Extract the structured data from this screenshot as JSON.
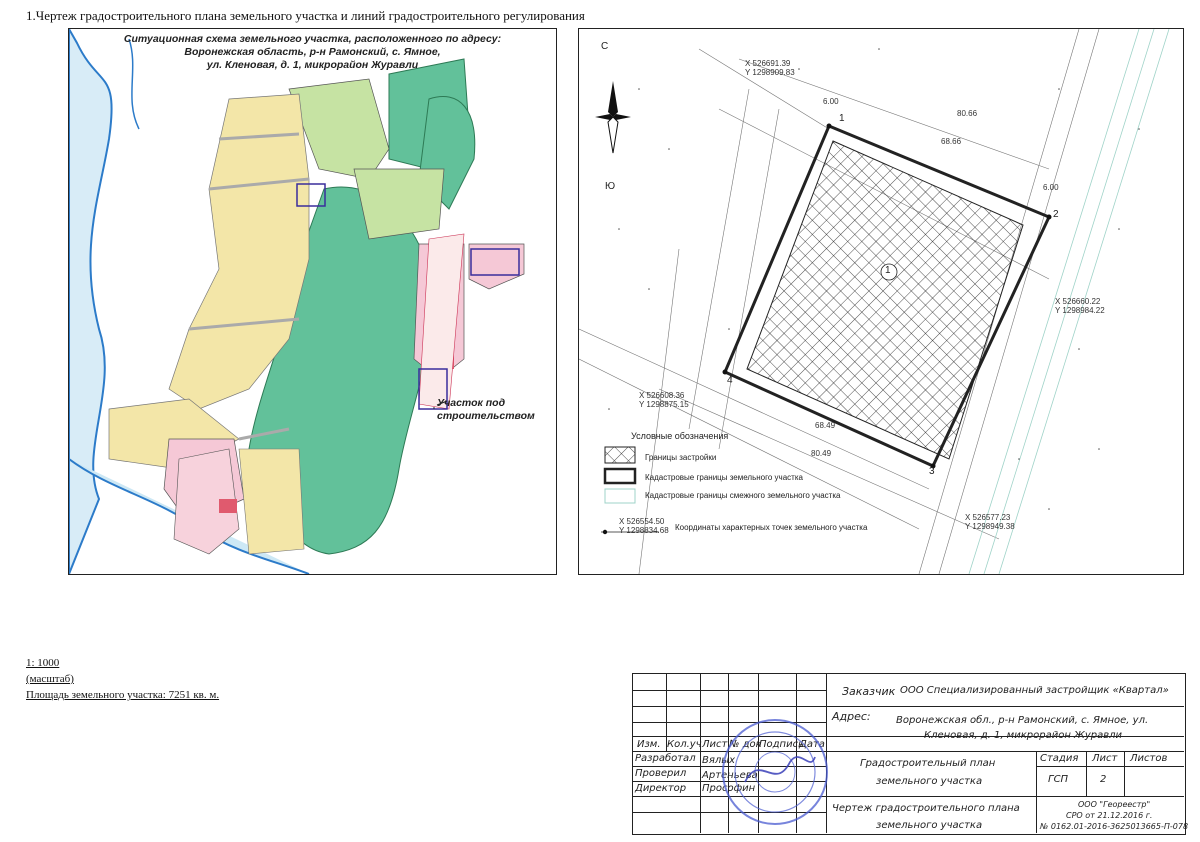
{
  "page_title": "1.Чертеж градостроительного плана земельного участка и линий градостроительного регулирования",
  "situational": {
    "title_line1": "Ситуационная схема земельного участка, расположенного по адресу:",
    "title_line2": "Воронежская область, р-н Рамонский, с. Ямное,",
    "title_line3": "ул. Кленовая, д. 1, микрорайон Журавли",
    "site_label_line1": "Участок под",
    "site_label_line2": "строительством"
  },
  "plan": {
    "compass_north": "С",
    "compass_south": "Ю",
    "points": [
      {
        "n": "1",
        "x": "X 526691.39",
        "y": "Y 1298909.83"
      },
      {
        "n": "2",
        "x": "X 526660.22",
        "y": "Y 1298984.22"
      },
      {
        "n": "3",
        "x": "X 526577.23",
        "y": "Y 1298949.38"
      },
      {
        "n": "4",
        "x": "X 526608.36",
        "y": "Y 1298875.15"
      }
    ],
    "zone_number": "1",
    "dims": [
      "6.00",
      "80.66",
      "68.66",
      "6.00",
      "80.49",
      "68.49"
    ],
    "legend": {
      "header": "Условные обозначения",
      "item1": "Границы застройки",
      "item2": "Кадастровые границы земельного участка",
      "item3": "Кадастровые границы смежного земельного участка",
      "item4_x": "X 526554.50",
      "item4_y": "Y 1298834.68",
      "item4_label": "Координаты характерных точек земельного участка"
    }
  },
  "scale": {
    "value": "1: 1000",
    "label": "(масштаб)",
    "area": "Площадь земельного участка: 7251 кв. м."
  },
  "stamp": {
    "customer_label": "Заказчик",
    "customer": "ООО Специализированный застройщик «Квартал»",
    "address_label": "Адрес:",
    "address_line1": "Воронежская обл., р-н Рамонский, с. Ямное, ул.",
    "address_line2": "Кленовая, д. 1, микрорайон Журавли",
    "head_izm": "Изм.",
    "head_kol": "Кол.уч",
    "head_list": "Лист",
    "head_doc": "№ док",
    "head_sign": "Подпись",
    "head_date": "Дата",
    "role1": "Разработал",
    "name1": "Вялых",
    "role2": "Проверил",
    "name2": "Артеньева",
    "role3": "Директор",
    "name3": "Прософин",
    "doc_title_line1": "Градостроительный план",
    "doc_title_line2": "земельного участка",
    "stage_label": "Стадия",
    "sheet_label": "Лист",
    "sheets_label": "Листов",
    "stage": "ГСП",
    "sheet": "2",
    "drawing_line1": "Чертеж градостроительного плана",
    "drawing_line2": "земельного участка",
    "org_line1": "ООО \"Геореестр\"",
    "org_line2": "СРО от 21.12.2016 г.",
    "org_line3": "№ 0162.01-2016-3625013665-П-078"
  }
}
